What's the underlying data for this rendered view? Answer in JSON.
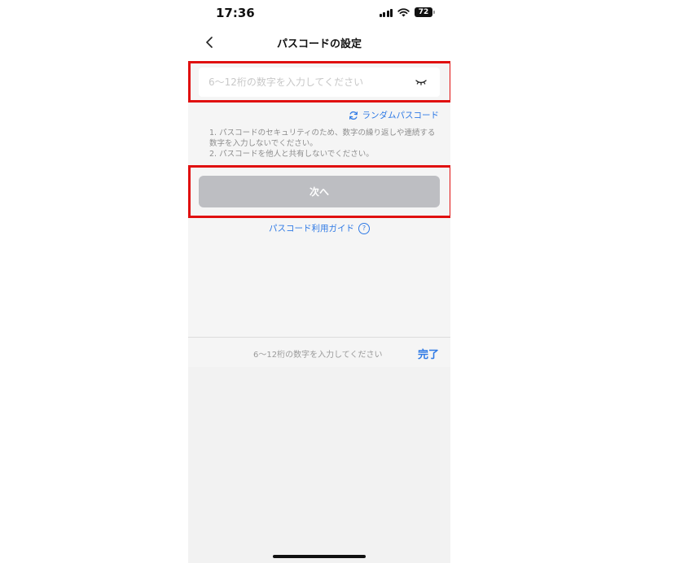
{
  "status_bar": {
    "time": "17:36",
    "battery": "72"
  },
  "navbar": {
    "title": "パスコードの設定"
  },
  "passcode_field": {
    "placeholder": "6～12桁の数字を入力してください",
    "value": ""
  },
  "random_link": {
    "label": "ランダムパスコード"
  },
  "notes": [
    "1.  パスコードのセキュリティのため、数字の繰り返しや連続する数字を入力しないでください。",
    "2.  パスコードを他人と共有しないでください。"
  ],
  "next_button": {
    "label": "次へ"
  },
  "guide_link": {
    "label": "パスコード利用ガイド"
  },
  "keyboard_bar": {
    "hint": "6～12桁の数字を入力してください",
    "done_label": "完了"
  },
  "colors": {
    "accent": "#2f7ae5",
    "highlight": "#e01010",
    "disabled_button": "#bdbec2"
  },
  "icons": [
    "back-chevron-icon",
    "eye-closed-icon",
    "refresh-icon",
    "help-circle-icon",
    "signal-icon",
    "wifi-icon",
    "battery-icon"
  ]
}
